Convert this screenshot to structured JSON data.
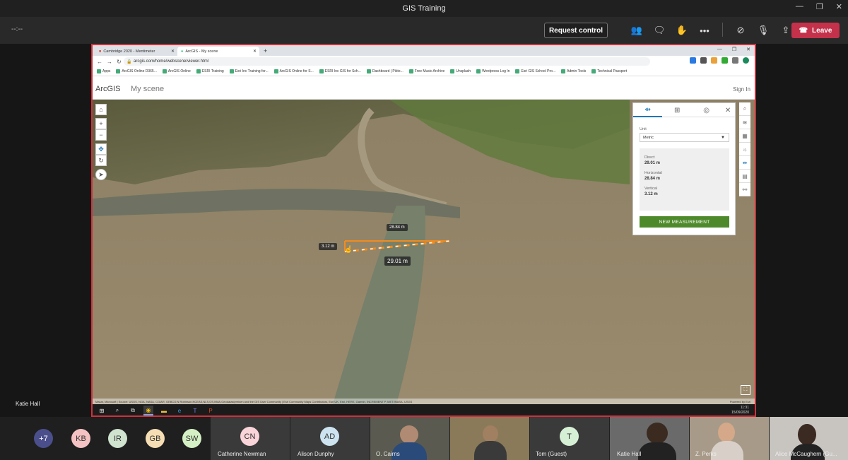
{
  "window": {
    "title": "GIS Training"
  },
  "call": {
    "timer": "--:--",
    "request_control_label": "Request control",
    "leave_label": "Leave",
    "presenter_name": "Katie Hall"
  },
  "browser": {
    "tabs": [
      {
        "label": "Cambridge 2020 - Mentimeter"
      },
      {
        "label": "ArcGIS - My scene"
      }
    ],
    "url": "arcgis.com/home/webscene/viewer.html",
    "bookmarks": [
      "Apps",
      "ArcGIS Online D365...",
      "ArcGIS Online",
      "ESRI Training",
      "Esri Inc Training for...",
      "ArcGIS Online for S...",
      "ESRI Inc GIS for Sch...",
      "Dashboard | Pikto...",
      "Free Music Archive",
      "Unsplash",
      "Wordpress Log In",
      "Esri GIS School Pro...",
      "Admin Tools",
      "Technical Passport"
    ]
  },
  "arcgis": {
    "logo": "ArcGIS",
    "scene_title": "My scene",
    "sign_in": "Sign In"
  },
  "measure": {
    "unit_label": "Unit",
    "unit_value": "Metric",
    "direct_label": "Direct",
    "direct_value": "29.01 m",
    "horizontal_label": "Horizontal",
    "horizontal_value": "28.84 m",
    "vertical_label": "Vertical",
    "vertical_value": "3.12 m",
    "new_button": "NEW MEASUREMENT",
    "map_label_horizontal": "28.84 m",
    "map_label_vertical": "3.12 m",
    "map_label_direct": "29.01 m"
  },
  "map": {
    "attribution": "Maxar, Microsoft | Source: USGS, NGA, NASA, CGIAR, GEBCO,N Robinson,NCEAS,NLS,OS,NMA,Geodatastyrelsen and the GIS User Community | Esri Community Maps Contributors, Esri UK, Esri, HERE, Garmin, INCREMENT P, METI/NASA, USGS",
    "powered_by": "Powered by Esri"
  },
  "taskbar": {
    "time": "11:31",
    "date": "15/09/2020"
  },
  "participants": {
    "overflow": "+7",
    "avatars": [
      {
        "initials": "KB",
        "color": "#f4c2c2"
      },
      {
        "initials": "IR",
        "color": "#cfe3cf"
      },
      {
        "initials": "GB",
        "color": "#f5deb3"
      },
      {
        "initials": "SW",
        "color": "#d4f0c4"
      }
    ],
    "tiles": [
      {
        "initials": "CN",
        "name": "Catherine Newman",
        "color": "#f9d4d8"
      },
      {
        "initials": "AD",
        "name": "Alison Dunphy",
        "color": "#cde4f0"
      },
      {
        "initials": "T",
        "name": "Tom (Guest)",
        "color": "#d6f0d6"
      }
    ],
    "video_names": [
      "O. Cairns",
      "Katie Hall",
      "Z. Perks",
      "Alice McCaughern (Gu..."
    ]
  },
  "colors": {
    "leave": "#c4314b",
    "share_border": "#d0303b",
    "new_measurement": "#4e8a2b",
    "measure_line": "#f28c1e"
  }
}
